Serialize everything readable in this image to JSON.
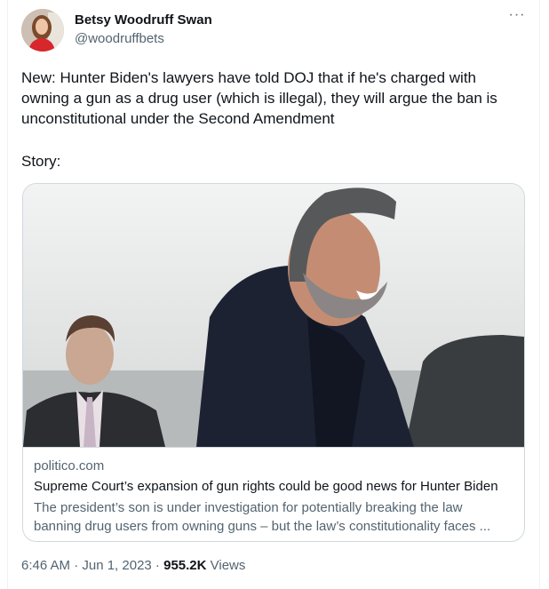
{
  "tweet": {
    "author_name": "Betsy Woodruff Swan",
    "author_handle": "@woodruffbets",
    "more_label": "···",
    "text": "New: Hunter Biden's lawyers have told DOJ that if he's charged with owning a gun as a drug user (which is illegal), they will argue the ban is unconstitutional under the Second Amendment",
    "story_label": "Story:",
    "timestamp": "6:46 AM · Jun 1, 2023",
    "separator": " · ",
    "views_count": "955.2K",
    "views_label": " Views"
  },
  "card": {
    "domain": "politico.com",
    "title": "Supreme Court’s expansion of gun rights could be good news for Hunter Biden",
    "description_line1": "The president’s son is under investigation for potentially breaking the law",
    "description_line2": "banning drug users from owning guns – but the law’s constitutionality faces ..."
  },
  "icons": {
    "more": "more-horizontal-icon"
  },
  "colors": {
    "primary_text": "#0f1419",
    "secondary_text": "#536471",
    "border": "#cfd9de"
  }
}
